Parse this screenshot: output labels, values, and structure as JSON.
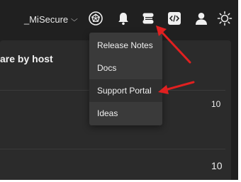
{
  "header": {
    "tenant_name": "_MiSecure",
    "tenant_caret": "⌵",
    "icons": [
      "pentagon-logo-icon",
      "bell-icon",
      "release-stack-icon",
      "code-icon",
      "user-icon",
      "sun-icon"
    ]
  },
  "card": {
    "title_fragment": "are by host",
    "rows": [
      {
        "value": "10"
      },
      {
        "value": "10"
      }
    ]
  },
  "dropdown": {
    "items": [
      {
        "label": "Release Notes"
      },
      {
        "label": "Docs"
      },
      {
        "label": "Support Portal"
      },
      {
        "label": "Ideas"
      }
    ]
  },
  "colors": {
    "background": "#202020",
    "card": "#2b2b2b",
    "dropdown": "#3a3a3a",
    "annotation_arrow": "#e02020"
  }
}
